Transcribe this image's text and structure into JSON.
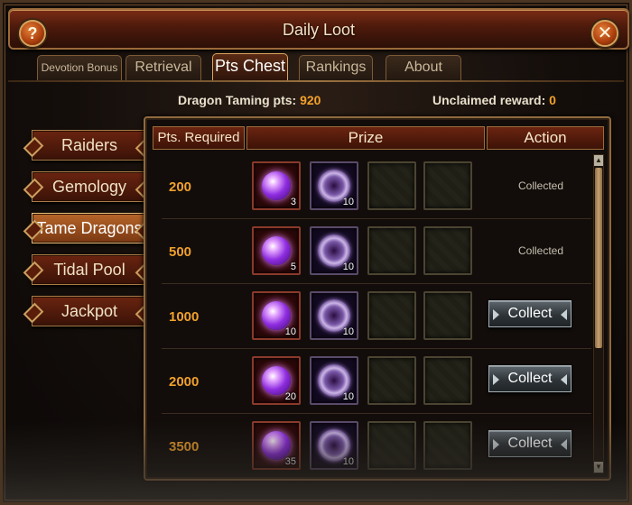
{
  "window": {
    "title": "Daily Loot",
    "help_label": "?",
    "close_label": "✕"
  },
  "tabs": [
    {
      "label": "Devotion Bonus",
      "active": false
    },
    {
      "label": "Retrieval",
      "active": false
    },
    {
      "label": "Pts Chest",
      "active": true
    },
    {
      "label": "Rankings",
      "active": false
    },
    {
      "label": "About",
      "active": false
    }
  ],
  "info": {
    "pts_label": "Dragon Taming pts:",
    "pts_value": "920",
    "reward_label": "Unclaimed reward:",
    "reward_value": "0"
  },
  "menu": [
    {
      "label": "Raiders",
      "active": false
    },
    {
      "label": "Gemology",
      "active": false
    },
    {
      "label": "Tame Dragons",
      "active": true
    },
    {
      "label": "Tidal Pool",
      "active": false
    },
    {
      "label": "Jackpot",
      "active": false
    }
  ],
  "table": {
    "headers": {
      "pts": "Pts. Required",
      "prize": "Prize",
      "action": "Action"
    },
    "rows": [
      {
        "pts": "200",
        "orb_qty": "3",
        "gem_qty": "10",
        "action": "Collected"
      },
      {
        "pts": "500",
        "orb_qty": "5",
        "gem_qty": "10",
        "action": "Collected"
      },
      {
        "pts": "1000",
        "orb_qty": "10",
        "gem_qty": "10",
        "action": "Collect"
      },
      {
        "pts": "2000",
        "orb_qty": "20",
        "gem_qty": "10",
        "action": "Collect"
      },
      {
        "pts": "3500",
        "orb_qty": "35",
        "gem_qty": "10",
        "action": "Collect"
      }
    ]
  },
  "colors": {
    "accent": "#f0a02c",
    "frame": "#8f6a3e",
    "header": "#6b2410"
  },
  "icons": {
    "orb": "purple-orb-icon",
    "gem": "violet-gem-icon",
    "empty": "empty-slot"
  }
}
